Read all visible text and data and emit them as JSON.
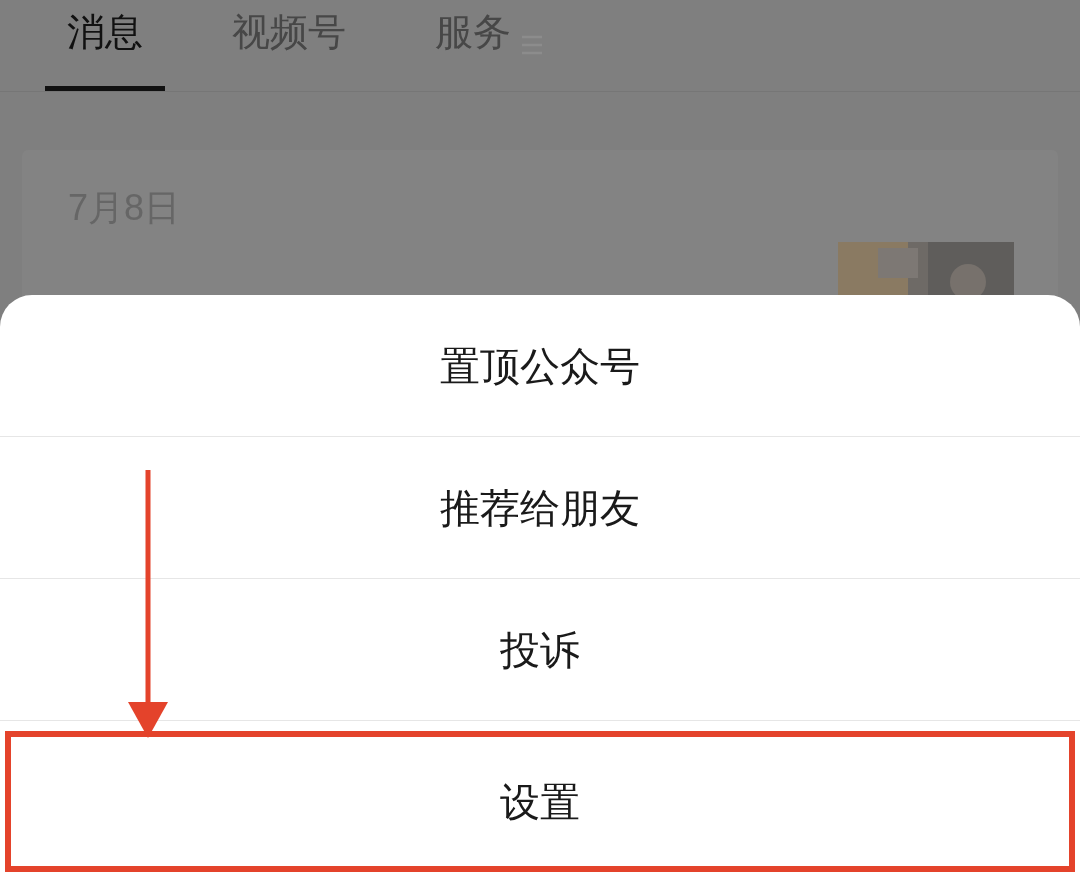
{
  "tabs": [
    {
      "label": "消息",
      "selected": true
    },
    {
      "label": "视频号",
      "selected": false
    },
    {
      "label": "服务",
      "selected": false
    }
  ],
  "card": {
    "date": "7月8日"
  },
  "action_sheet": {
    "items": [
      {
        "label": "置顶公众号",
        "highlighted": false
      },
      {
        "label": "推荐给朋友",
        "highlighted": false
      },
      {
        "label": "投诉",
        "highlighted": false
      },
      {
        "label": "设置",
        "highlighted": true
      }
    ]
  }
}
